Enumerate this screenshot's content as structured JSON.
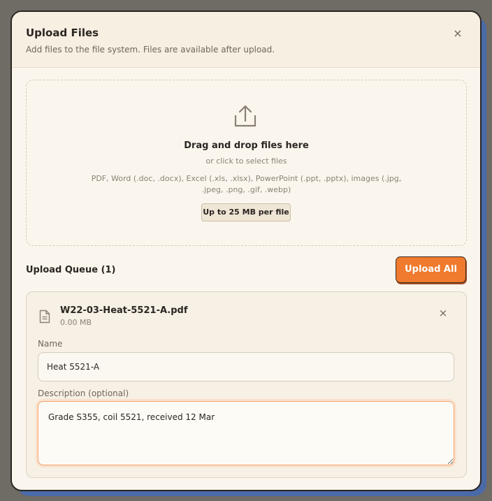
{
  "modal": {
    "title": "Upload Files",
    "subtitle": "Add files to the file system. Files are available after upload.",
    "close_icon": "×"
  },
  "dropzone": {
    "icon": "upload-icon",
    "title": "Drag and drop files here",
    "subtitle": "or click to select files",
    "accepted_types": "PDF, Word (.doc, .docx), Excel (.xls, .xlsx), PowerPoint (.ppt, .pptx), images (.jpg, .jpeg, .png, .gif, .webp)",
    "size_limit": "Up to 25 MB per file"
  },
  "queue": {
    "title": "Upload Queue (1)",
    "upload_all_label": "Upload All",
    "files": [
      {
        "file_name": "W22-03-Heat-5521-A.pdf",
        "file_size": "0.00 MB",
        "remove_icon": "×",
        "name_label": "Name",
        "name_value": "Heat 5521-A",
        "description_label": "Description (optional)",
        "description_value": "Grade S355, coil 5521, received 12 Mar"
      }
    ]
  },
  "colors": {
    "accent": "#f07a2d",
    "background_overlay": "#6f6c66",
    "modal_bg": "#faf6ee",
    "focus_ring": "#f2a36c"
  }
}
